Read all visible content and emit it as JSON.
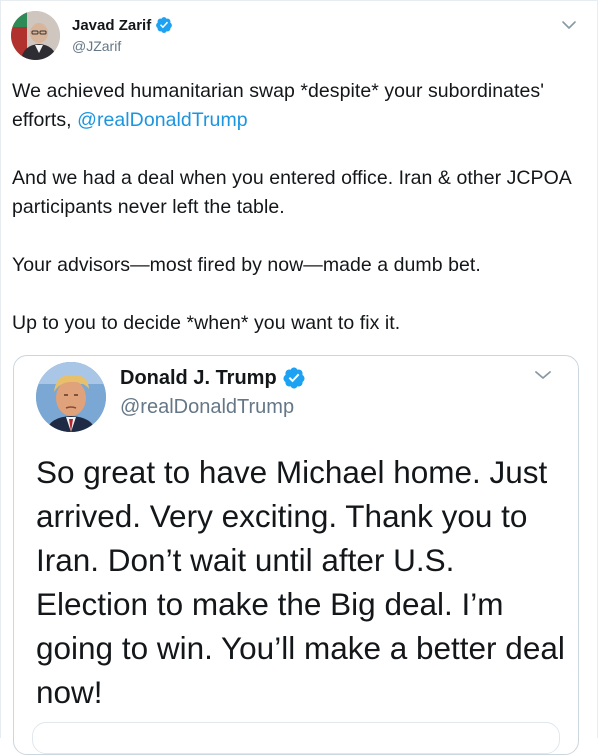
{
  "tweet": {
    "author": {
      "name": "Javad Zarif",
      "handle": "@JZarif",
      "verified_icon": "verified-badge-icon",
      "avatar": "profile-photo"
    },
    "menu_icon": "chevron-down-icon",
    "paragraphs": [
      {
        "text": "We achieved humanitarian swap *despite* your subordinates' efforts, ",
        "mention": "@realDonaldTrump"
      },
      {
        "text": "And we had a deal when you entered office. Iran & other JCPOA participants never left the table."
      },
      {
        "text": "Your advisors—most fired by now—made a dumb bet."
      },
      {
        "text": "Up to you to decide *when* you want to fix it."
      }
    ]
  },
  "quoted_tweet": {
    "author": {
      "name": "Donald J. Trump",
      "handle": "@realDonaldTrump",
      "verified_icon": "verified-badge-icon",
      "avatar": "profile-photo"
    },
    "menu_icon": "chevron-down-icon",
    "text": "So great to have Michael home. Just arrived. Very exciting. Thank you to Iran. Don’t wait until after U.S. Election to make the Big deal. I’m going to win. You’ll make a better deal now!"
  },
  "colors": {
    "text": "#14171a",
    "secondary": "#657786",
    "link": "#1b95e0",
    "verified": "#1da1f2",
    "border": "#e6ecf0"
  }
}
